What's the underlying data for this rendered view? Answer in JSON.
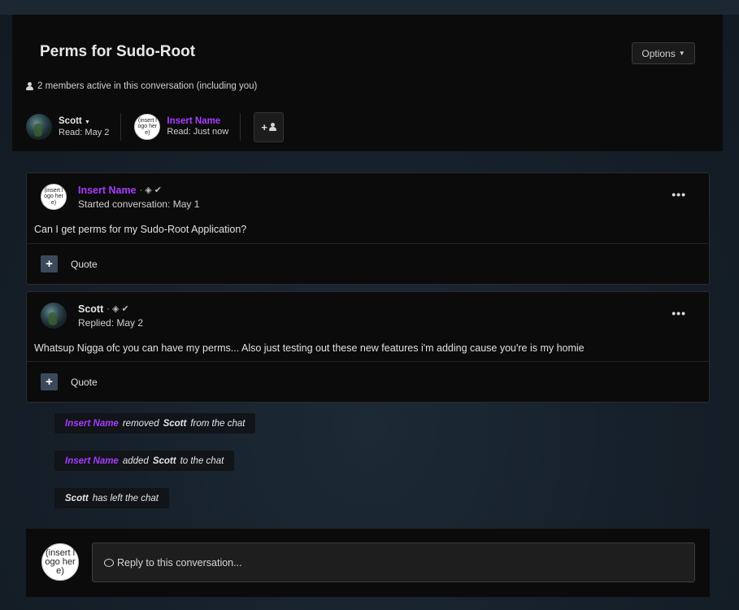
{
  "conversation": {
    "title": "Perms for Sudo-Root",
    "options_label": "Options",
    "active_text": "2 members active in this conversation (including you)"
  },
  "participants": [
    {
      "name": "Scott",
      "read": "Read: May 2",
      "color": "#e6e6e6"
    },
    {
      "name": "Insert Name",
      "read": "Read: Just now",
      "color": "#a93cff"
    }
  ],
  "avatar_logo_text": "(insert logo here)",
  "posts": [
    {
      "author": "Insert Name",
      "author_color": "#a93cff",
      "meta": "Started conversation: May 1",
      "body": "Can I get perms for my Sudo-Root Application?",
      "quote_label": "Quote"
    },
    {
      "author": "Scott",
      "author_color": "#e6e6e6",
      "meta": "Replied: May 2",
      "body": "Whatsup Nigga ofc you can have my perms... Also just testing out these new features i'm adding cause you're is my homie",
      "quote_label": "Quote"
    }
  ],
  "events": [
    {
      "actor": "Insert Name",
      "action": "removed",
      "target": "Scott",
      "suffix": "from the chat"
    },
    {
      "actor": "Insert Name",
      "action": "added",
      "target": "Scott",
      "suffix": "to the chat"
    },
    {
      "actor": "Scott",
      "action": "has left the chat"
    }
  ],
  "reply": {
    "placeholder": "Reply to this conversation..."
  },
  "colors": {
    "accent_purple": "#a93cff",
    "panel": "#0b0b0b"
  }
}
